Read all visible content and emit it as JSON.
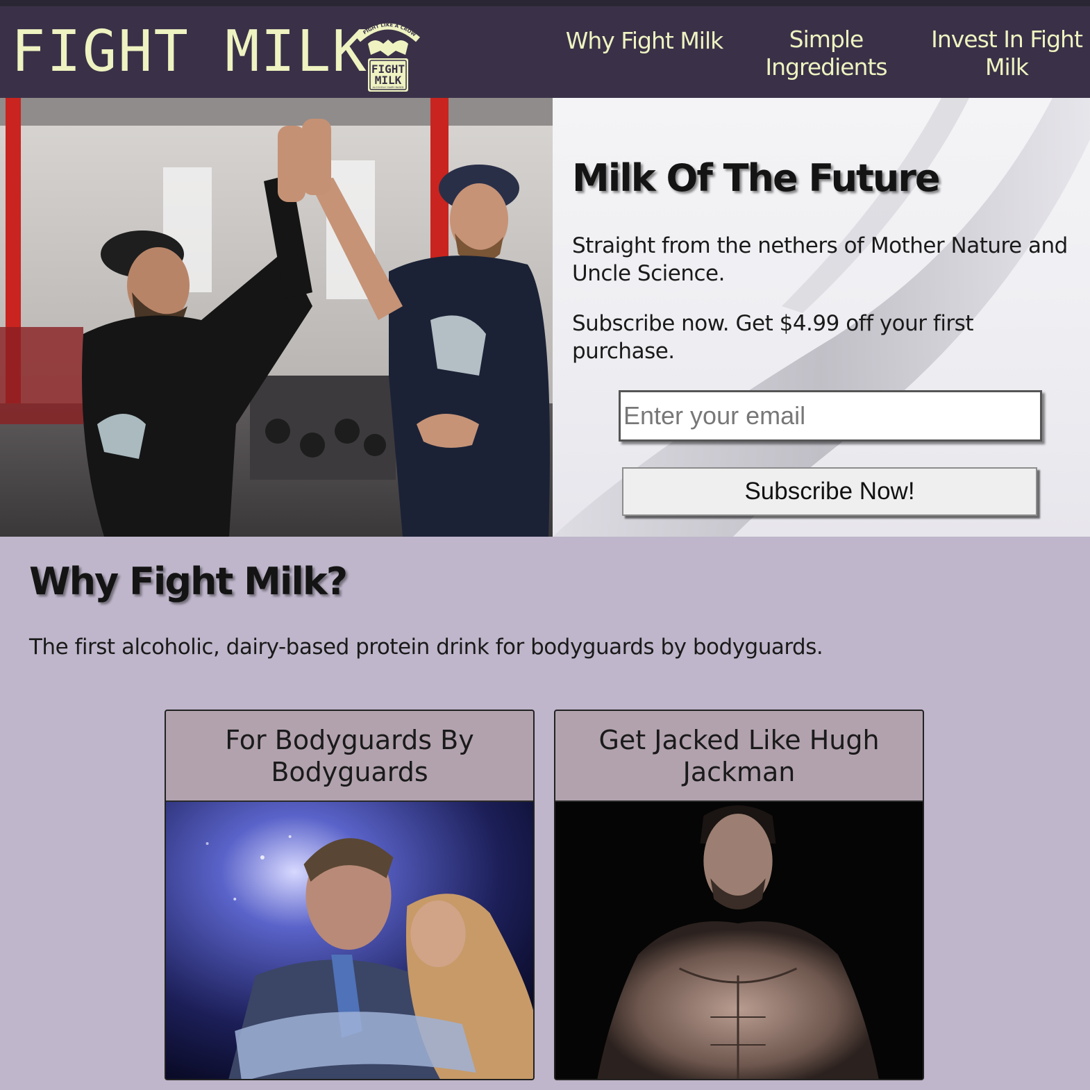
{
  "header": {
    "brand": "FIGHT MILK",
    "logo": {
      "arc_text": "FIGHT LIKE A CROW",
      "label_line1": "FIGHT",
      "label_line2": "MILK",
      "sub_text": "ALCOHOLIC DAIRY BASED"
    },
    "nav": [
      {
        "label": "Why Fight Milk"
      },
      {
        "label": "Simple Ingredients"
      },
      {
        "label": "Invest In Fight Milk"
      }
    ]
  },
  "hero": {
    "title": "Milk Of The Future",
    "tagline": "Straight from the nethers of Mother Nature and Uncle Science.",
    "offer": "Subscribe now. Get $4.99 off your first purchase.",
    "email_placeholder": "Enter your email",
    "email_value": "",
    "subscribe_label": "Subscribe Now!"
  },
  "why": {
    "title": "Why Fight Milk?",
    "description": "The first alcoholic, dairy-based protein drink for bodyguards by bodyguards.",
    "cards": [
      {
        "title": "For Bodyguards By Bodyguards"
      },
      {
        "title": "Get Jacked Like Hugh Jackman"
      }
    ]
  },
  "colors": {
    "header_bg": "#3a3148",
    "brand_text": "#eef3c1",
    "page_bg": "#bfb6cb",
    "card_header_bg": "#b2a2ae"
  }
}
